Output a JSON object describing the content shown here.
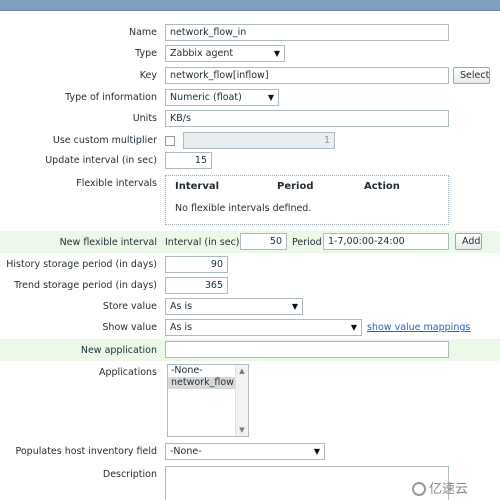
{
  "form": {
    "name": {
      "label": "Name",
      "value": "network_flow_in"
    },
    "type": {
      "label": "Type",
      "value": "Zabbix agent"
    },
    "key": {
      "label": "Key",
      "value": "network_flow[inflow]",
      "select_label": "Select"
    },
    "type_of_info": {
      "label": "Type of information",
      "value": "Numeric (float)"
    },
    "units": {
      "label": "Units",
      "value": "KB/s"
    },
    "custom_multiplier": {
      "label": "Use custom multiplier",
      "value": "1"
    },
    "update_interval": {
      "label": "Update interval (in sec)",
      "value": "15"
    },
    "flexible_intervals": {
      "label": "Flexible intervals",
      "headers": [
        "Interval",
        "Period",
        "Action"
      ],
      "empty_text": "No flexible intervals defined."
    },
    "new_flexible_interval": {
      "label": "New flexible interval",
      "interval_label": "Interval (in sec)",
      "interval_value": "50",
      "period_label": "Period",
      "period_value": "1-7,00:00-24:00",
      "add_label": "Add"
    },
    "history": {
      "label": "History storage period (in days)",
      "value": "90"
    },
    "trend": {
      "label": "Trend storage period (in days)",
      "value": "365"
    },
    "store_value": {
      "label": "Store value",
      "value": "As is"
    },
    "show_value": {
      "label": "Show value",
      "value": "As is",
      "link": "show value mappings"
    },
    "new_application": {
      "label": "New application",
      "value": ""
    },
    "applications": {
      "label": "Applications",
      "options": [
        "-None-",
        "network_flow"
      ],
      "selected_index": 1
    },
    "inventory": {
      "label": "Populates host inventory field",
      "value": "-None-"
    },
    "description": {
      "label": "Description",
      "value": ""
    }
  },
  "watermark": "亿速云",
  "icons": {
    "dropdown": "triangle-down-icon",
    "scroll_up": "scroll-up-icon",
    "scroll_down": "scroll-down-icon",
    "watermark": "cloud-logo-icon"
  }
}
